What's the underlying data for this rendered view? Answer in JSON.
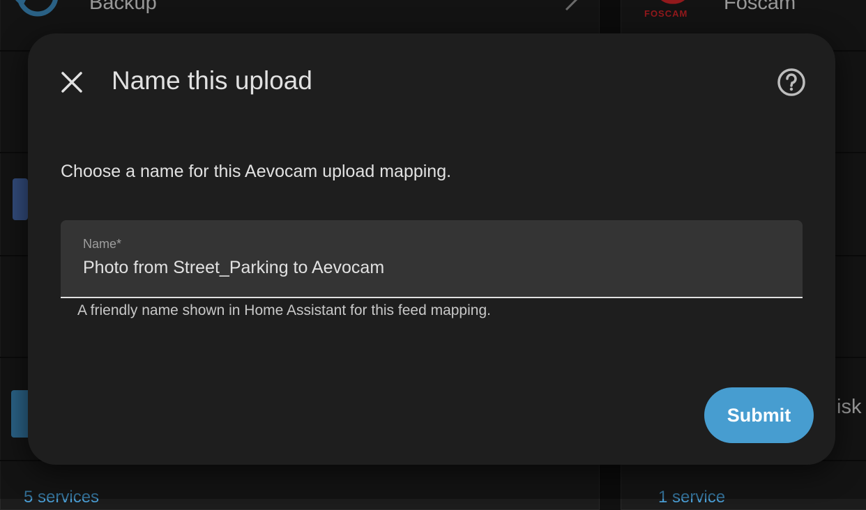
{
  "background": {
    "backup_label": "Backup",
    "foscam_label": "Foscam",
    "foscam_logo_text": "FOSCAM",
    "partial_disk_text": "isk",
    "left_services_link": "5 services",
    "right_services_link": "1 service"
  },
  "dialog": {
    "title": "Name this upload",
    "description": "Choose a name for this Aevocam upload mapping.",
    "name_field": {
      "label": "Name*",
      "value": "Photo from Street_Parking to Aevocam",
      "helper": "A friendly name shown in Home Assistant for this feed mapping."
    },
    "submit_label": "Submit"
  },
  "icons": {
    "close": "close-icon",
    "help": "help-circle-icon",
    "backup": "backup-icon",
    "chevron": "chevron-right-icon"
  },
  "colors": {
    "accent": "#479dd0",
    "dialog_bg": "#1e1e1e",
    "field_bg": "#343434",
    "foscam_red": "#d8262a"
  }
}
